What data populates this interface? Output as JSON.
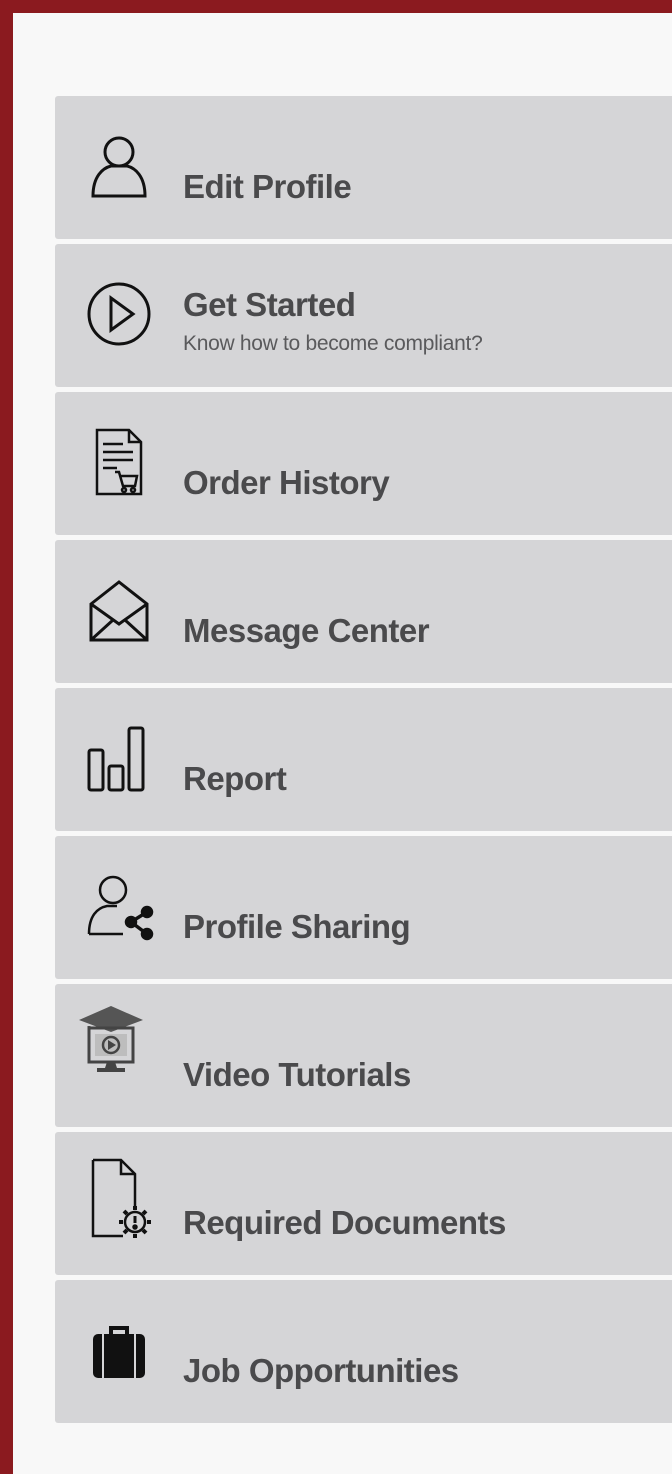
{
  "menu": {
    "items": [
      {
        "label": "Edit Profile",
        "icon": "user-icon"
      },
      {
        "label": "Get Started",
        "sublabel": "Know how to become compliant?",
        "icon": "play-circle-icon"
      },
      {
        "label": "Order History",
        "icon": "receipt-cart-icon"
      },
      {
        "label": "Message Center",
        "icon": "envelope-open-icon"
      },
      {
        "label": "Report",
        "icon": "bar-chart-icon"
      },
      {
        "label": "Profile Sharing",
        "icon": "user-share-icon"
      },
      {
        "label": "Video Tutorials",
        "icon": "video-tutorial-icon"
      },
      {
        "label": "Required Documents",
        "icon": "document-alert-icon"
      },
      {
        "label": "Job Opportunities",
        "icon": "briefcase-icon"
      }
    ]
  },
  "colors": {
    "frame_border": "#8b1a1f",
    "item_background": "#d5d5d7",
    "text": "#4a4a4c",
    "page_background": "#f8f8f8"
  }
}
